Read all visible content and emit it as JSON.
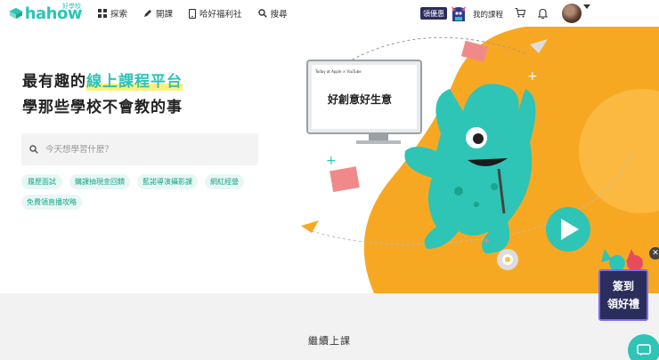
{
  "header": {
    "logo_text": "hahow",
    "logo_tag": "好學校",
    "nav": [
      {
        "label": "探索",
        "icon": "grid-icon"
      },
      {
        "label": "開課",
        "icon": "pencil-icon"
      },
      {
        "label": "哈好福利社",
        "icon": "phone-icon"
      },
      {
        "label": "搜尋",
        "icon": "search-icon"
      }
    ],
    "promo_label": "領優惠",
    "my_courses": "我的課程"
  },
  "hero": {
    "title_prefix": "最有趣的",
    "title_highlight": "線上課程平台",
    "title_line2": "學那些學校不會教的事",
    "search_placeholder": "今天想學習什麼？",
    "chips": [
      "履歷面試",
      "購課抽現金回饋",
      "藍諾導演攝影課",
      "網紅經營",
      "免費領直播攻略"
    ],
    "monitor_text": "好創意好生意",
    "monitor_small": "Today at Apple × YouTube"
  },
  "section": {
    "title": "繼續上課"
  },
  "float_promo": {
    "text_line1": "簽到",
    "text_line2": "領好禮"
  },
  "colors": {
    "brand": "#2ec4b6",
    "orange": "#f7a823",
    "navy": "#2b2d5c"
  }
}
